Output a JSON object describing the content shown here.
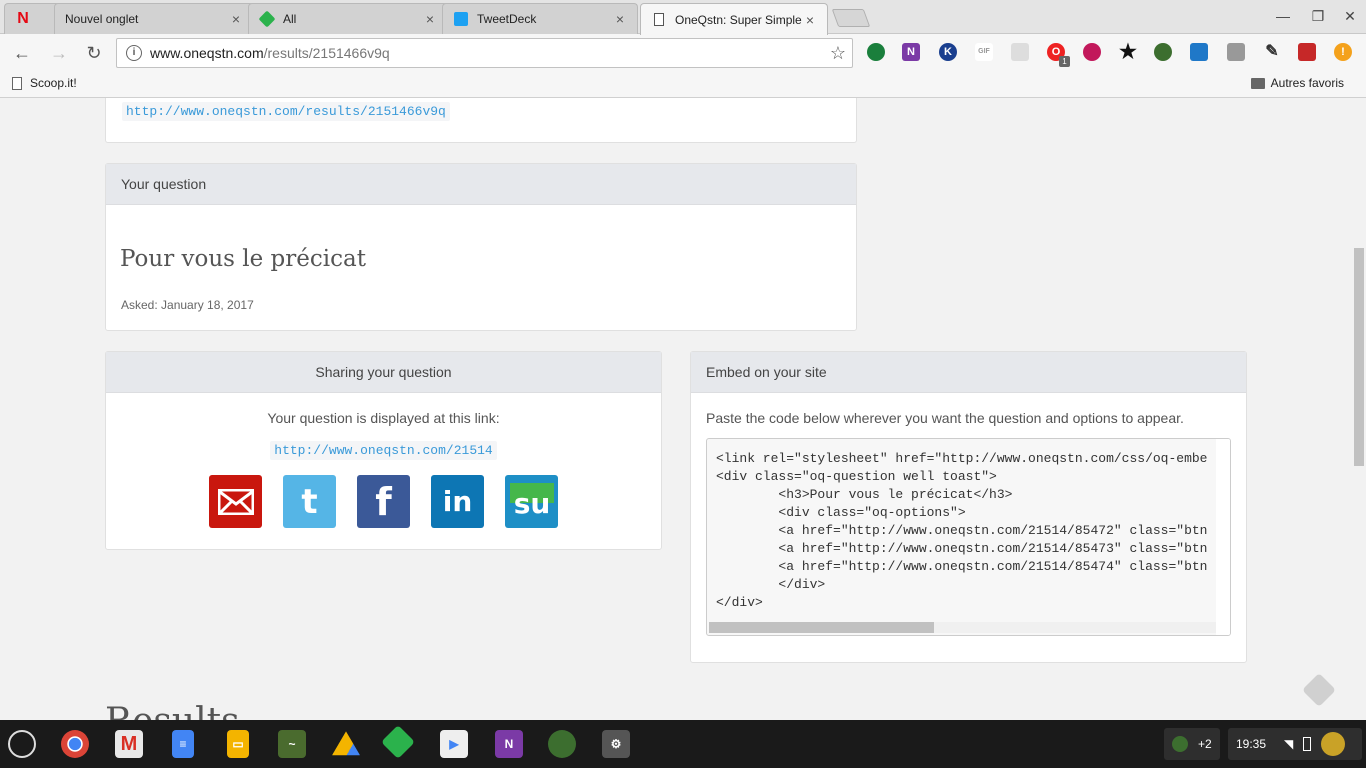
{
  "tabs": [
    {
      "title": "",
      "icon": "netflix-icon"
    },
    {
      "title": "Nouvel onglet",
      "icon": "blank-icon"
    },
    {
      "title": "All",
      "icon": "feedly-icon"
    },
    {
      "title": "TweetDeck",
      "icon": "twitter-icon"
    },
    {
      "title": "OneQstn: Super Simple",
      "icon": "page-icon"
    }
  ],
  "omnibox": {
    "domain": "www.oneqstn.com",
    "path": "/results/2151466v9q"
  },
  "extensions": {
    "badge_count": "1"
  },
  "bookmarks": {
    "left": "Scoop.it!",
    "right": "Autres favoris"
  },
  "results_link_panel": {
    "url": "http://www.oneqstn.com/results/2151466v9q"
  },
  "question_panel": {
    "header": "Your question",
    "title": "Pour vous le précicat",
    "asked": "Asked: January 18, 2017"
  },
  "sharing_panel": {
    "header": "Sharing your question",
    "text": "Your question is displayed at this link:",
    "link": "http://www.oneqstn.com/21514",
    "networks": [
      "email",
      "twitter",
      "facebook",
      "linkedin",
      "stumbleupon"
    ]
  },
  "embed_panel": {
    "header": "Embed on your site",
    "instructions": "Paste the code below wherever you want the question and options to appear.",
    "code": "<link rel=\"stylesheet\" href=\"http://www.oneqstn.com/css/oq-embe\n<div class=\"oq-question well toast\">\n        <h3>Pour vous le précicat</h3>\n        <div class=\"oq-options\">\n        <a href=\"http://www.oneqstn.com/21514/85472\" class=\"btn\n        <a href=\"http://www.oneqstn.com/21514/85473\" class=\"btn\n        <a href=\"http://www.oneqstn.com/21514/85474\" class=\"btn\n        </div>\n</div>"
  },
  "results_heading": "Results",
  "shelf": {
    "notification_count": "+2",
    "time": "19:35"
  },
  "colors": {
    "link": "#3a9ad9",
    "panel_head": "#e6e8ec",
    "email": "#c9170e",
    "twitter": "#55b5e6",
    "facebook": "#3b5998",
    "linkedin": "#0d76b4",
    "stumbleupon": "#1e8fc6"
  }
}
